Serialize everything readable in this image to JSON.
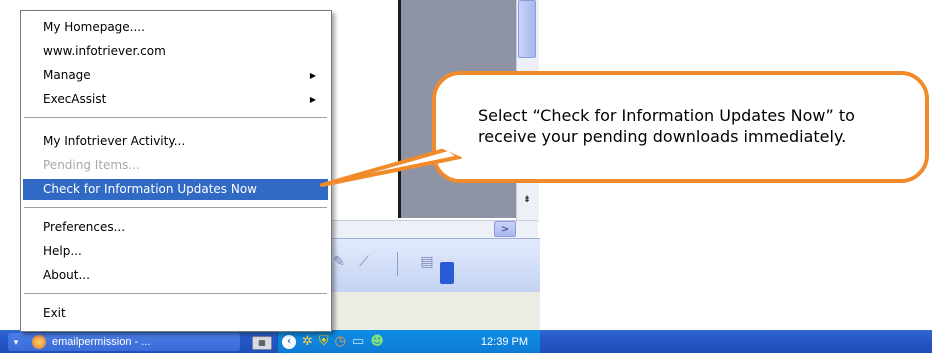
{
  "menu": {
    "items": [
      {
        "label": "My Homepage....",
        "state": "normal",
        "submenu": false
      },
      {
        "label": "www.infotriever.com",
        "state": "normal",
        "submenu": false
      },
      {
        "label": "Manage",
        "state": "normal",
        "submenu": true
      },
      {
        "label": "ExecAssist",
        "state": "normal",
        "submenu": true
      },
      {
        "label": "My Infotriever Activity...",
        "state": "normal",
        "submenu": false
      },
      {
        "label": "Pending Items...",
        "state": "disabled",
        "submenu": false
      },
      {
        "label": "Check for Information Updates Now",
        "state": "highlighted",
        "submenu": false
      },
      {
        "label": "Preferences...",
        "state": "normal",
        "submenu": false
      },
      {
        "label": "Help...",
        "state": "normal",
        "submenu": false
      },
      {
        "label": "About...",
        "state": "normal",
        "submenu": false
      },
      {
        "label": "Exit",
        "state": "normal",
        "submenu": false
      }
    ],
    "submenu_arrow": "▶"
  },
  "callout": {
    "text": "Select “Check for Information Updates Now” to receive your pending downloads immediately.",
    "border_color": "#f08a2a"
  },
  "taskbar": {
    "task_button_label": "emailpermission - ...",
    "clock": "12:39 PM",
    "tray_icons": [
      "chevron-left-icon",
      "network-icon",
      "shield-icon",
      "clock-app-icon",
      "monitor-icon",
      "users-icon"
    ]
  },
  "colors": {
    "menu_highlight": "#316ac5",
    "taskbar_blue": "#2456c7",
    "tray_blue": "#0d7bd6",
    "callout_orange": "#f08a2a"
  }
}
